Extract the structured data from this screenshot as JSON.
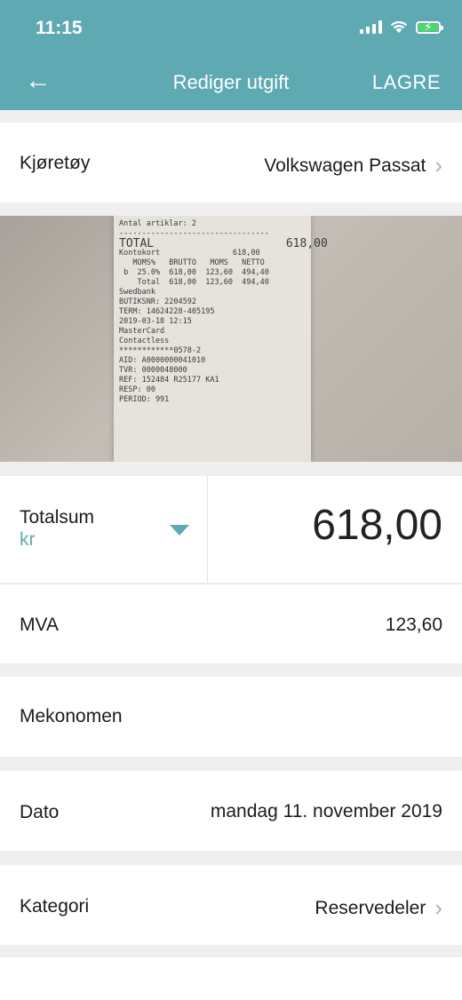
{
  "status": {
    "time": "11:15"
  },
  "nav": {
    "title": "Rediger utgift",
    "save_label": "LAGRE"
  },
  "vehicle": {
    "label": "Kjøretøy",
    "value": "Volkswagen Passat"
  },
  "receipt_lines": [
    "Antal artiklar: 2",
    "---------------------------------",
    "TOTAL                   618,00",
    "Kontokort                618,00",
    "",
    "   MOMS%   BRUTTO   MOMS   NETTO",
    " b  25.0%  618,00  123,60  494,40",
    "    Total  618,00  123,60  494,40",
    "",
    "Swedbank",
    "BUTIKSNR: 2204592",
    "TERM: 14624228-405195",
    "2019-03-18 12:15",
    "",
    "MasterCard",
    "Contactless",
    "************0578-2",
    "AID: A0000000041010",
    "TVR: 0000048000",
    "REF: 152484 R25177 KA1",
    "RESP: 00",
    "PERIOD: 991"
  ],
  "total": {
    "label": "Totalsum",
    "currency": "kr",
    "amount": "618,00"
  },
  "vat": {
    "label": "MVA",
    "value": "123,60"
  },
  "merchant": {
    "value": "Mekonomen"
  },
  "date": {
    "label": "Dato",
    "value": "mandag 11. november 2019"
  },
  "category": {
    "label": "Kategori",
    "value": "Reservedeler"
  },
  "colors": {
    "accent": "#5fa9b3",
    "background": "#efefef"
  }
}
